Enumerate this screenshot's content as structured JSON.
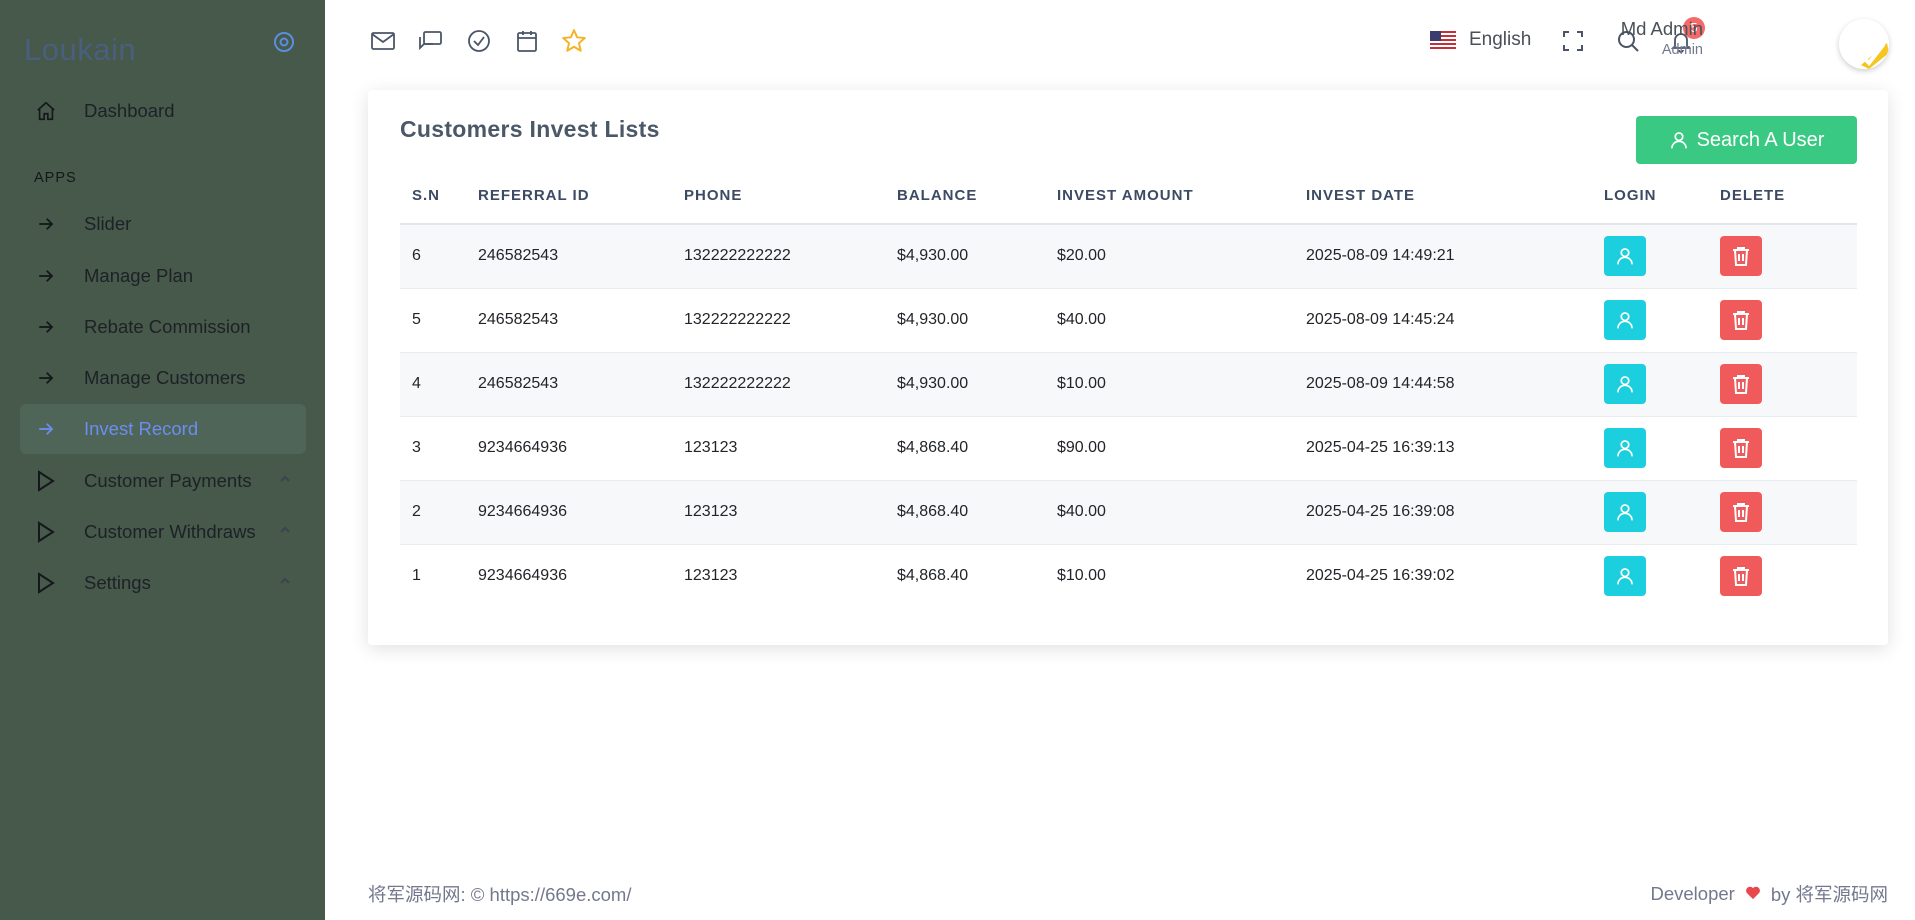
{
  "brand": "Loukain",
  "sidebar": {
    "dashboard": "Dashboard",
    "section": "APPS",
    "items": [
      {
        "label": "Slider"
      },
      {
        "label": "Manage Plan"
      },
      {
        "label": "Rebate Commission"
      },
      {
        "label": "Manage Customers"
      },
      {
        "label": "Invest Record"
      }
    ],
    "groups": [
      {
        "label": "Customer Payments"
      },
      {
        "label": "Customer Withdraws"
      },
      {
        "label": "Settings"
      }
    ]
  },
  "topbar": {
    "language": "English",
    "notification_count": "5",
    "user_name": "Md Admin",
    "user_role": "Admin"
  },
  "card": {
    "title": "Customers Invest Lists",
    "search_button": "Search A User",
    "columns": [
      "S.N",
      "REFERRAL ID",
      "PHONE",
      "BALANCE",
      "INVEST AMOUNT",
      "INVEST DATE",
      "LOGIN",
      "DELETE"
    ],
    "rows": [
      {
        "sn": "6",
        "referral": "246582543",
        "phone": "132222222222",
        "balance": "$4,930.00",
        "amount": "$20.00",
        "date": "2025-08-09 14:49:21"
      },
      {
        "sn": "5",
        "referral": "246582543",
        "phone": "132222222222",
        "balance": "$4,930.00",
        "amount": "$40.00",
        "date": "2025-08-09 14:45:24"
      },
      {
        "sn": "4",
        "referral": "246582543",
        "phone": "132222222222",
        "balance": "$4,930.00",
        "amount": "$10.00",
        "date": "2025-08-09 14:44:58"
      },
      {
        "sn": "3",
        "referral": "9234664936",
        "phone": "123123",
        "balance": "$4,868.40",
        "amount": "$90.00",
        "date": "2025-04-25 16:39:13"
      },
      {
        "sn": "2",
        "referral": "9234664936",
        "phone": "123123",
        "balance": "$4,868.40",
        "amount": "$40.00",
        "date": "2025-04-25 16:39:08"
      },
      {
        "sn": "1",
        "referral": "9234664936",
        "phone": "123123",
        "balance": "$4,868.40",
        "amount": "$10.00",
        "date": "2025-04-25 16:39:02"
      }
    ]
  },
  "footer": {
    "left": "将军源码网: © https://669e.com/",
    "developer": "Developer",
    "by": "by 将军源码网"
  },
  "colors": {
    "sidebar_bg": "#46594a",
    "active_link": "#6c8ef0",
    "search_button": "#3ac983",
    "login_button": "#1ccfde",
    "delete_button": "#f05a5a",
    "badge": "#f46a6a",
    "star_icon": "#f5b225"
  },
  "icons": {
    "topbar": [
      "mail-icon",
      "chat-icon",
      "check-circle-icon",
      "calendar-icon",
      "star-icon",
      "us-flag-icon",
      "fullscreen-icon",
      "search-icon",
      "bell-icon"
    ],
    "sidebar": [
      "home-icon",
      "arrow-right-icon",
      "play-icon",
      "chevron-up-icon"
    ],
    "table": [
      "user-icon",
      "trash-icon"
    ],
    "footer": [
      "heart-icon"
    ]
  }
}
